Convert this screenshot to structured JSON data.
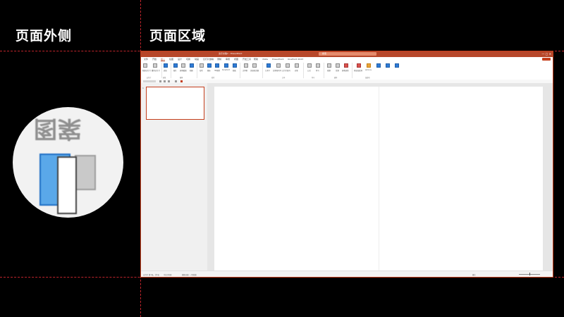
{
  "labels": {
    "outside": "页面外侧",
    "page_area": "页面区域"
  },
  "app": {
    "title": "演示文稿1 - PowerPoint",
    "search_placeholder": "搜索",
    "window_controls": "— ▢ ✕"
  },
  "menu_tabs": [
    "文件",
    "开始",
    "插入",
    "绘图",
    "设计",
    "切换",
    "动画",
    "幻灯片放映",
    "录制",
    "审阅",
    "视图",
    "开发工具",
    "帮助",
    "iSlide",
    "PowerPoint",
    "OnePoint 2023"
  ],
  "ribbon": {
    "groups": [
      "剪贴板",
      "幻灯片",
      "表格",
      "图像",
      "形状",
      "文本",
      "符号",
      "媒体",
      "加载项"
    ],
    "items": [
      "新建幻灯片",
      "重用幻灯片",
      "表格",
      "图片",
      "屏幕截图",
      "相册",
      "形状",
      "图标",
      "3D模型",
      "SmartArt",
      "图表",
      "文本框",
      "页眉和页脚",
      "艺术字",
      "日期和时间",
      "幻灯片编号",
      "对象",
      "公式",
      "符号",
      "视频",
      "音频",
      "屏幕录制",
      "获取加载项",
      "Add-ins"
    ]
  },
  "thumbnail": {
    "number": "1"
  },
  "status": {
    "slide_info": "幻灯片 第1张，共1张",
    "language": "中文(中国)",
    "accessibility": "辅助功能: 一切就绪",
    "notes": "备注"
  },
  "colors": {
    "accent": "#c43e1c",
    "titlebar": "#b7472a",
    "guide_line": "#c0242b",
    "magnifier_blue": "#5aa8e9"
  },
  "magnifier_text": "图案"
}
